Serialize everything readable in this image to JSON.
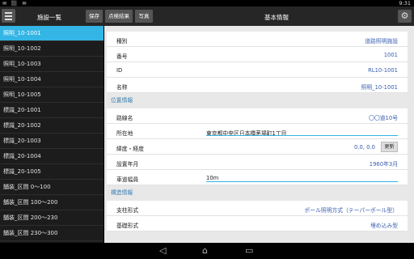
{
  "status": {
    "left_icons": "✉ ⬛ ✉",
    "time": "9:31"
  },
  "appbar": {
    "sidebar_title": "施設一覧",
    "save": "保存",
    "inspect": "点検結果",
    "photo": "写真",
    "main_title": "基本情報"
  },
  "sidebar": {
    "items": [
      "照明_10-1001",
      "照明_10-1002",
      "照明_10-1003",
      "照明_10-1004",
      "照明_10-1005",
      "標識_20-1001",
      "標識_20-1002",
      "標識_20-1003",
      "標識_20-1004",
      "標識_20-1005",
      "舗装_区間 0〜100",
      "舗装_区間 100〜200",
      "舗装_区間 200〜230",
      "舗装_区間 230〜300"
    ]
  },
  "basic": [
    {
      "label": "種別",
      "value": "道路照明施設"
    },
    {
      "label": "番号",
      "value": "1001"
    },
    {
      "label": "ID",
      "value": "RL10-1001"
    },
    {
      "label": "名称",
      "value": "照明_10-1001"
    }
  ],
  "location": {
    "title": "位置情報",
    "route_label": "路線名",
    "route_value": "〇〇道10号",
    "address_label": "所在地",
    "address_value": "東京都中央区日本橋茅場町1丁目",
    "coord_label": "緯度・経度",
    "coord_value": "0.0, 0.0",
    "update": "更新",
    "year_label": "設置年月",
    "year_value": "1960年3月",
    "width_label": "車道幅員",
    "width_value": "10m"
  },
  "structure": {
    "title": "構造情報",
    "support_label": "支柱形式",
    "support_value": "ポール照明方式（テーパーポール型）",
    "base_label": "基礎形式",
    "base_value": "埋め込み型"
  },
  "nav": {
    "back": "◁",
    "home": "⌂",
    "recent": "▭"
  }
}
